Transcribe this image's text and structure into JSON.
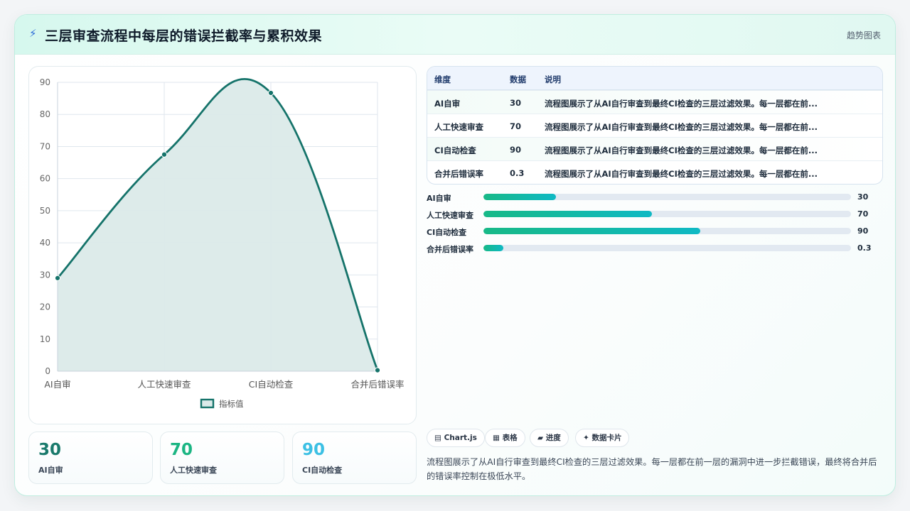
{
  "header": {
    "icon": "lightning-icon",
    "title": "三层审查流程中每层的错误拦截率与累积效果",
    "tag": "趋势图表"
  },
  "chart_data": {
    "type": "area",
    "categories": [
      "AI自审",
      "人工快速审查",
      "CI自动检查",
      "合并后错误率"
    ],
    "series": [
      {
        "name": "指标值",
        "values": [
          29,
          67.5,
          86.7,
          0.3
        ]
      }
    ],
    "ylim": [
      0,
      90
    ],
    "yticks": [
      0,
      10,
      20,
      30,
      40,
      50,
      60,
      70,
      80,
      90
    ],
    "grid": true,
    "legend": "bottom",
    "colors": {
      "line": "#15736a",
      "fill": "#dbeae9"
    }
  },
  "kpis": [
    {
      "value": "30",
      "label": "AI自审",
      "color": "#1a7a6c"
    },
    {
      "value": "70",
      "label": "人工快速审查",
      "color": "#1bb583"
    },
    {
      "value": "90",
      "label": "CI自动检查",
      "color": "#3cc0e4"
    }
  ],
  "table": {
    "headers": [
      "维度",
      "数据",
      "说明"
    ],
    "rows": [
      {
        "dim": "AI自审",
        "val": "30",
        "note": "流程图展示了从AI自行审查到最终CI检查的三层过滤效果。每一层都在前..."
      },
      {
        "dim": "人工快速审查",
        "val": "70",
        "note": "流程图展示了从AI自行审查到最终CI检查的三层过滤效果。每一层都在前..."
      },
      {
        "dim": "CI自动检查",
        "val": "90",
        "note": "流程图展示了从AI自行审查到最终CI检查的三层过滤效果。每一层都在前..."
      },
      {
        "dim": "合并后错误率",
        "val": "0.3",
        "note": "流程图展示了从AI自行审查到最终CI检查的三层过滤效果。每一层都在前..."
      }
    ]
  },
  "progress": [
    {
      "label": "AI自审",
      "value": "30",
      "fraction": 0.197
    },
    {
      "label": "人工快速审查",
      "value": "70",
      "fraction": 0.458
    },
    {
      "label": "CI自动检查",
      "value": "90",
      "fraction": 0.589
    },
    {
      "label": "合并后错误率",
      "value": "0.3",
      "fraction": 0.054
    }
  ],
  "chips": [
    {
      "icon": "chart-icon",
      "glyph": "▤",
      "label": "Chart.js"
    },
    {
      "icon": "table-icon",
      "glyph": "▦",
      "label": "表格"
    },
    {
      "icon": "progress-icon",
      "glyph": "▰",
      "label": "进度"
    },
    {
      "icon": "sparkle-icon",
      "glyph": "✦",
      "label": "数据卡片"
    }
  ],
  "description": "流程图展示了从AI自行审查到最终CI检查的三层过滤效果。每一层都在前一层的漏洞中进一步拦截错误，最终将合并后的错误率控制在极低水平。"
}
